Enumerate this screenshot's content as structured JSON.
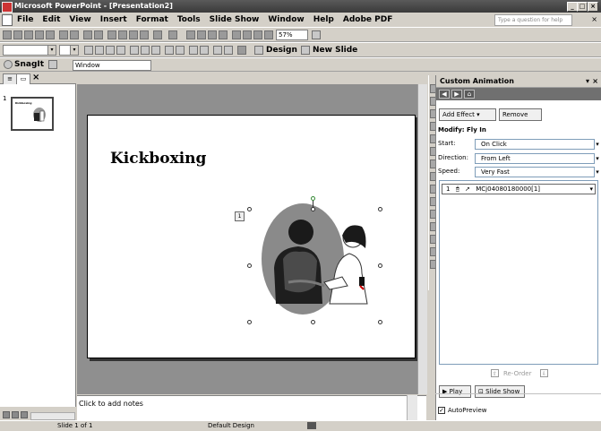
{
  "window": {
    "title": "Microsoft PowerPoint - [Presentation2]",
    "controls": [
      "_",
      "□",
      "×"
    ]
  },
  "menubar": {
    "items": [
      "File",
      "Edit",
      "View",
      "Insert",
      "Format",
      "Tools",
      "Slide Show",
      "Window",
      "Help",
      "Adobe PDF"
    ],
    "help_placeholder": "Type a question for help",
    "close_glyph": "× "
  },
  "toolbar": {
    "zoom": "57%",
    "design_label": "Design",
    "new_slide_label": "New Slide"
  },
  "snagit_bar": {
    "snagit_label": "SnagIt",
    "capture_mode": "Window"
  },
  "outline_pane": {
    "slide_number": "1",
    "thumb_title": "Kickboxing"
  },
  "slide": {
    "title": "Kickboxing",
    "animation_tag": "1"
  },
  "notes": {
    "placeholder": "Click to add notes"
  },
  "task_pane": {
    "title": "Custom Animation",
    "add_effect_label": "Add Effect",
    "remove_label": "Remove",
    "modify_label": "Modify: Fly In",
    "start_label": "Start:",
    "start_value": "On Click",
    "direction_label": "Direction:",
    "direction_value": "From Left",
    "speed_label": "Speed:",
    "speed_value": "Very Fast",
    "effects": [
      {
        "order": "1",
        "name": "MCj04080180000[1]"
      }
    ],
    "reorder_label": "Re-Order",
    "play_label": "Play",
    "slideshow_label": "Slide Show",
    "autopreview_label": "AutoPreview",
    "autopreview_checked": true
  },
  "statusbar": {
    "slide_of": "Slide 1 of 1",
    "design": "Default Design"
  }
}
